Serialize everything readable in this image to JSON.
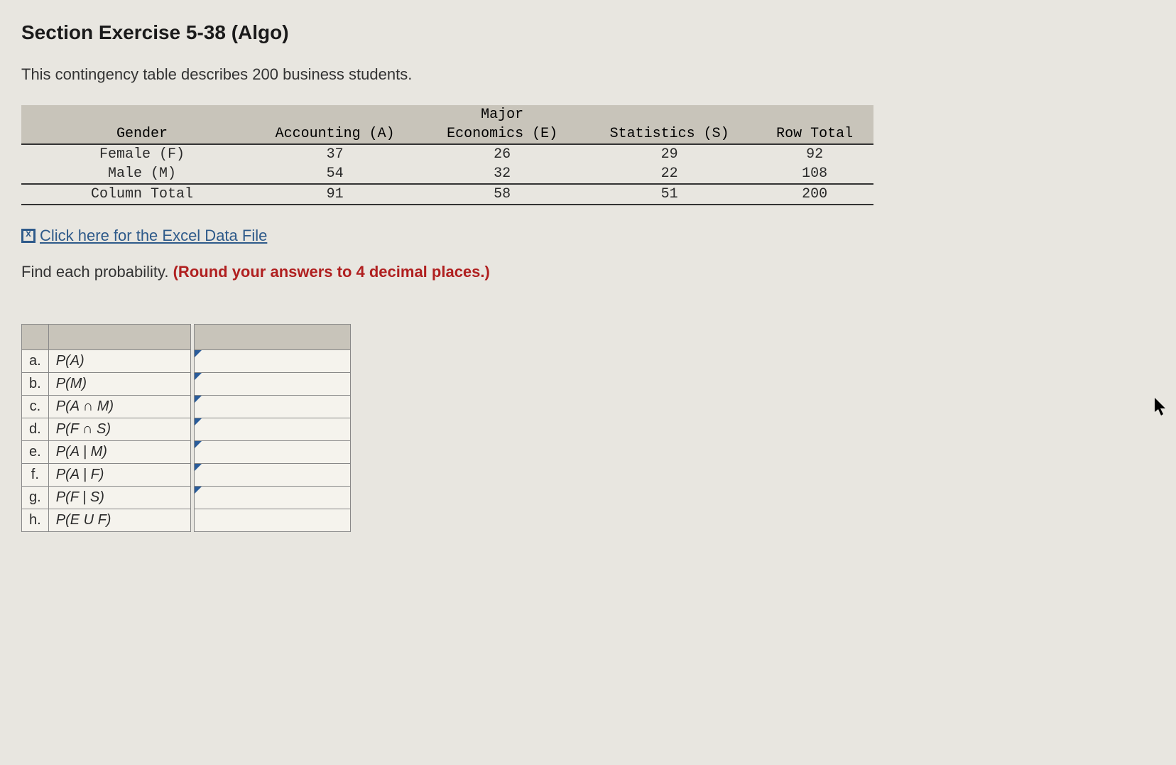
{
  "title": "Section Exercise 5-38 (Algo)",
  "description": "This contingency table describes 200 business students.",
  "contingency": {
    "majorHeader": "Major",
    "genderHeader": "Gender",
    "columns": [
      "Accounting (A)",
      "Economics (E)",
      "Statistics (S)",
      "Row Total"
    ],
    "rows": [
      {
        "label": "Female (F)",
        "values": [
          "37",
          "26",
          "29",
          "92"
        ]
      },
      {
        "label": "Male (M)",
        "values": [
          "54",
          "32",
          "22",
          "108"
        ]
      },
      {
        "label": "Column Total",
        "values": [
          "91",
          "58",
          "51",
          "200"
        ]
      }
    ]
  },
  "excelLink": "Click here for the Excel Data File",
  "instruction": {
    "plain": "Find each probability. ",
    "emph": "(Round your answers to 4 decimal places.)"
  },
  "answers": {
    "items": [
      {
        "letter": "a.",
        "label": "P(A)"
      },
      {
        "letter": "b.",
        "label": "P(M)"
      },
      {
        "letter": "c.",
        "label": "P(A ∩ M)"
      },
      {
        "letter": "d.",
        "label": "P(F ∩ S)"
      },
      {
        "letter": "e.",
        "label": "P(A | M)"
      },
      {
        "letter": "f.",
        "label": "P(A | F)"
      },
      {
        "letter": "g.",
        "label": "P(F | S)"
      },
      {
        "letter": "h.",
        "label": "P(E U F)"
      }
    ]
  }
}
